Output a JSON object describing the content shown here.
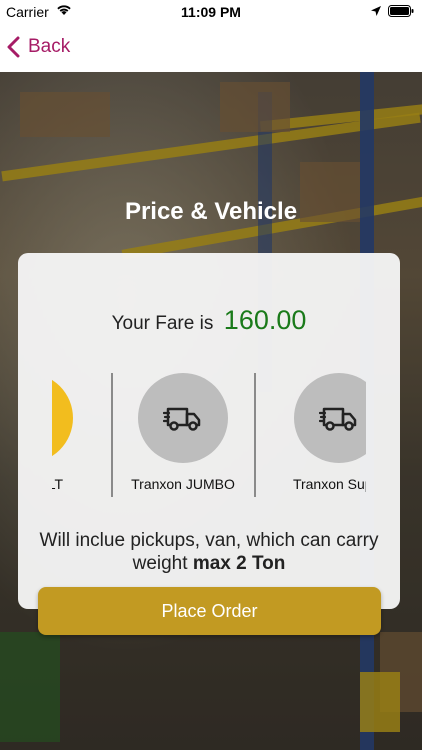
{
  "status_bar": {
    "carrier": "Carrier",
    "time": "11:09 PM"
  },
  "nav": {
    "back_label": "Back",
    "accent_color": "#a61c66"
  },
  "page": {
    "title": "Price & Vehicle"
  },
  "fare": {
    "label": "Your Fare is",
    "value": "160.00",
    "value_color": "#1a7a1a"
  },
  "vehicles": [
    {
      "name": "Tranxon LT",
      "icon": "truck-icon",
      "selected": true
    },
    {
      "name": "Tranxon JUMBO",
      "icon": "truck-icon",
      "selected": false
    },
    {
      "name": "Tranxon Super",
      "icon": "truck-icon",
      "selected": false
    }
  ],
  "description": {
    "text": "Will inclue pickups, van, which can carry weight",
    "emphasis": "max 2 Ton"
  },
  "actions": {
    "place_order_label": "Place Order",
    "button_color": "#c29a22"
  }
}
